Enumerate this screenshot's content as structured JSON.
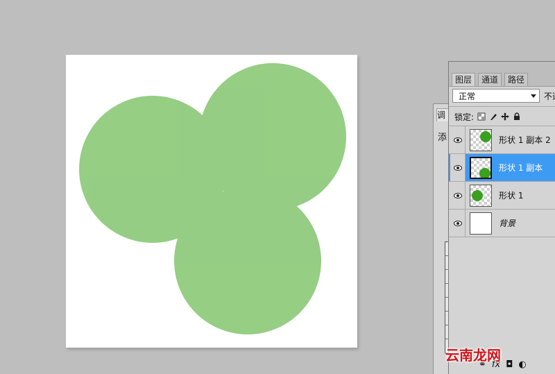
{
  "canvas": {
    "shape_color": "#7cc26a",
    "overlap_color": "#5aa83c"
  },
  "adjust_panel": {
    "tab_label": "调",
    "add_text": "添"
  },
  "layers_panel": {
    "tabs": [
      {
        "label": "图层",
        "active": true
      },
      {
        "label": "通道",
        "active": false
      },
      {
        "label": "路径",
        "active": false
      }
    ],
    "blend_mode": "正常",
    "opacity_label": "不透",
    "lock_label": "锁定:",
    "layers": [
      {
        "name": "形状 1 副本 2",
        "selected": false,
        "dot_pos": "top-right"
      },
      {
        "name": "形状 1 副本",
        "selected": true,
        "dot_pos": "bottom-right"
      },
      {
        "name": "形状 1",
        "selected": false,
        "dot_pos": "center-left"
      },
      {
        "name": "背景",
        "selected": false,
        "dot_pos": "none"
      }
    ],
    "selection_color": "#3d9bf4",
    "footer_icons": [
      "link-icon",
      "fx-icon",
      "mask-icon",
      "adjustment-icon"
    ],
    "footer_fx": "fx"
  },
  "watermark": "云南龙网"
}
